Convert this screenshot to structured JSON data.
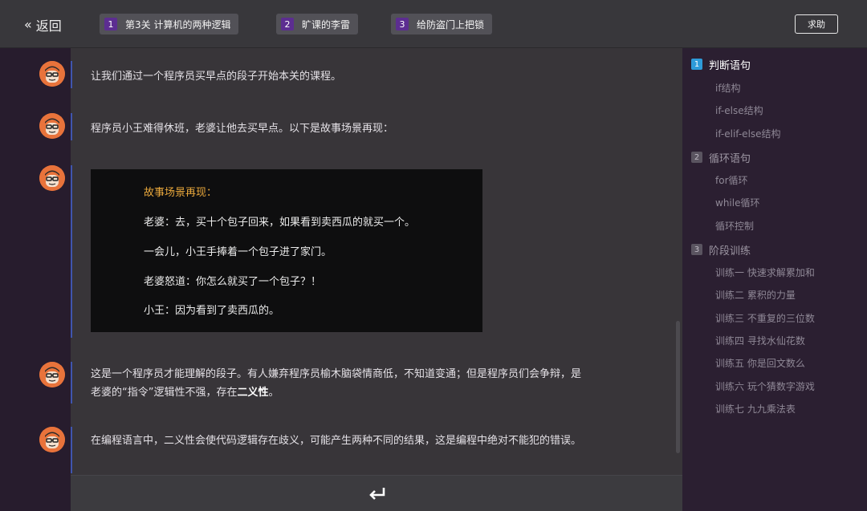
{
  "topbar": {
    "back_label": "返回",
    "tabs": [
      {
        "num": "1",
        "label": "第3关 计算机的两种逻辑"
      },
      {
        "num": "2",
        "label": "旷课的李雷"
      },
      {
        "num": "3",
        "label": "给防盗门上把锁"
      }
    ],
    "help_label": "求助"
  },
  "messages": [
    {
      "text": "让我们通过一个程序员买早点的段子开始本关的课程。"
    },
    {
      "text": "程序员小王难得休班，老婆让他去买早点。以下是故事场景再现："
    },
    {
      "text_before": "这是一个程序员才能理解的段子。有人嫌弃程序员榆木脑袋情商低，不知道变通；但是程序员们会争辩，是老婆的“指令”逻辑性不强，存在",
      "bold": "二义性",
      "text_after": "。"
    },
    {
      "text": "在编程语言中，二义性会使代码逻辑存在歧义，可能产生两种不同的结果，这是编程中绝对不能犯的错误。"
    }
  ],
  "story": {
    "title": "故事场景再现：",
    "lines": [
      "老婆：去，买十个包子回来，如果看到卖西瓜的就买一个。",
      "一会儿，小王手捧着一个包子进了家门。",
      "老婆怒道：你怎么就买了一个包子？！",
      "小王：因为看到了卖西瓜的。"
    ]
  },
  "sidebar": {
    "sections": [
      {
        "num": "1",
        "label": "判断语句",
        "active": true,
        "items": [
          "if结构",
          "if-else结构",
          "if-elif-else结构"
        ]
      },
      {
        "num": "2",
        "label": "循环语句",
        "active": false,
        "items": [
          "for循环",
          "while循环",
          "循环控制"
        ]
      },
      {
        "num": "3",
        "label": "阶段训练",
        "active": false,
        "items": [
          "训练一 快速求解累加和",
          "训练二 累积的力量",
          "训练三 不重复的三位数",
          "训练四 寻找水仙花数",
          "训练五 你是回文数么",
          "训练六 玩个猜数字游戏",
          "训练七 九九乘法表"
        ]
      }
    ]
  },
  "icons": {
    "back": "double-chevron-left-icon",
    "enter": "enter-return-icon",
    "avatar": "cartoon-programmer-avatar"
  },
  "colors": {
    "accent_purple": "#5c2d91",
    "accent_blue": "#2e9bd9",
    "message_bar": "#3f55ae",
    "story_title": "#e9a83c",
    "avatar_orange": "#e8733b"
  }
}
